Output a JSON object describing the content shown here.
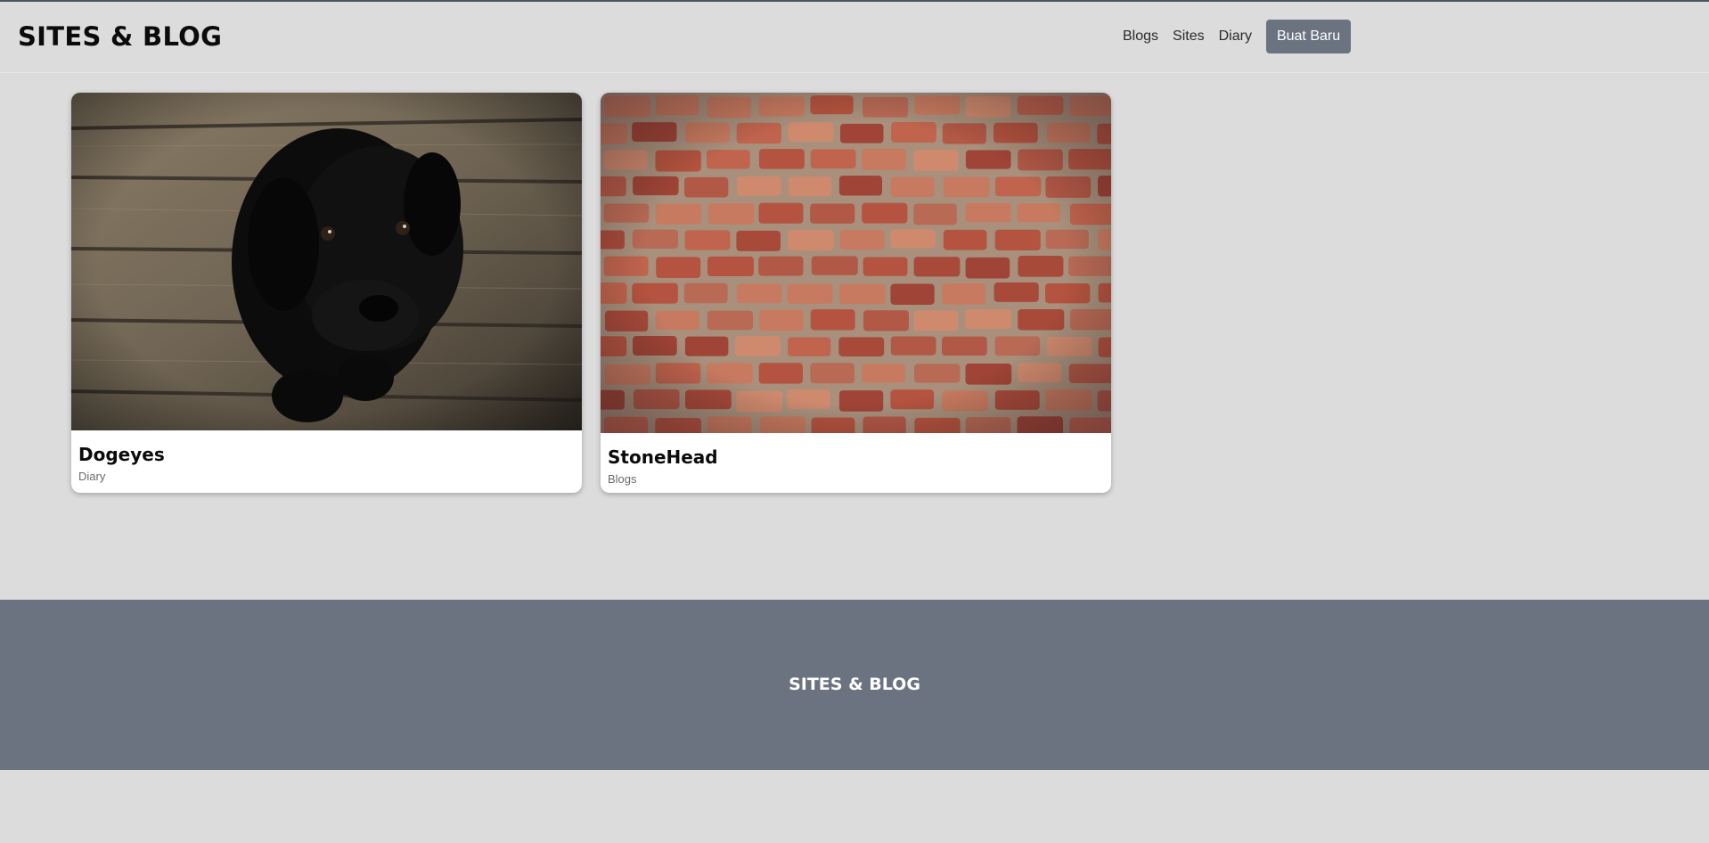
{
  "header": {
    "brand": "SITES & BLOG",
    "nav": [
      {
        "label": "Blogs"
      },
      {
        "label": "Sites"
      },
      {
        "label": "Diary"
      }
    ],
    "new_button": "Buat Baru"
  },
  "cards": [
    {
      "title": "Dogeyes",
      "category": "Diary",
      "image": "black-puppy-on-wooden-floor-photo"
    },
    {
      "title": "StoneHead",
      "category": "Blogs",
      "image": "red-brick-wall-photo"
    }
  ],
  "footer": {
    "brand": "SITES & BLOG"
  },
  "colors": {
    "background": "#dcdcdc",
    "footer": "#6b7280",
    "button": "#6b7280",
    "top_line": "#4b5563"
  }
}
